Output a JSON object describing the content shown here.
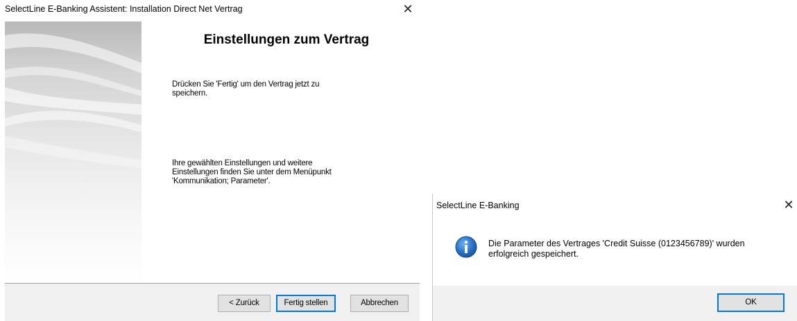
{
  "wizard": {
    "title": "SelectLine E-Banking Assistent: Installation Direct Net Vertrag",
    "close_glyph": "✕",
    "heading": "Einstellungen zum Vertrag",
    "text1": "Drücken Sie 'Fertig' um den Vertrag jetzt zu\nspeichern.",
    "text2": "Ihre gewählten Einstellungen und weitere\nEinstellungen finden Sie unter dem Menüpunkt\n'Kommunikation; Parameter'.",
    "buttons": {
      "back": "< Zurück",
      "finish": "Fertig stellen",
      "cancel": "Abbrechen"
    }
  },
  "messagebox": {
    "title": "SelectLine E-Banking",
    "close_glyph": "✕",
    "icon": "info-icon",
    "message": "Die Parameter des Vertrages 'Credit Suisse (0123456789)' wurden\nerfolgreich gespeichert.",
    "ok_label": "OK"
  },
  "colors": {
    "button_face": "#e1e1e1",
    "button_border": "#adadad",
    "default_button_border": "#0078d7",
    "footer_bg": "#f0f0f0",
    "info_icon": "#1e63b5"
  }
}
